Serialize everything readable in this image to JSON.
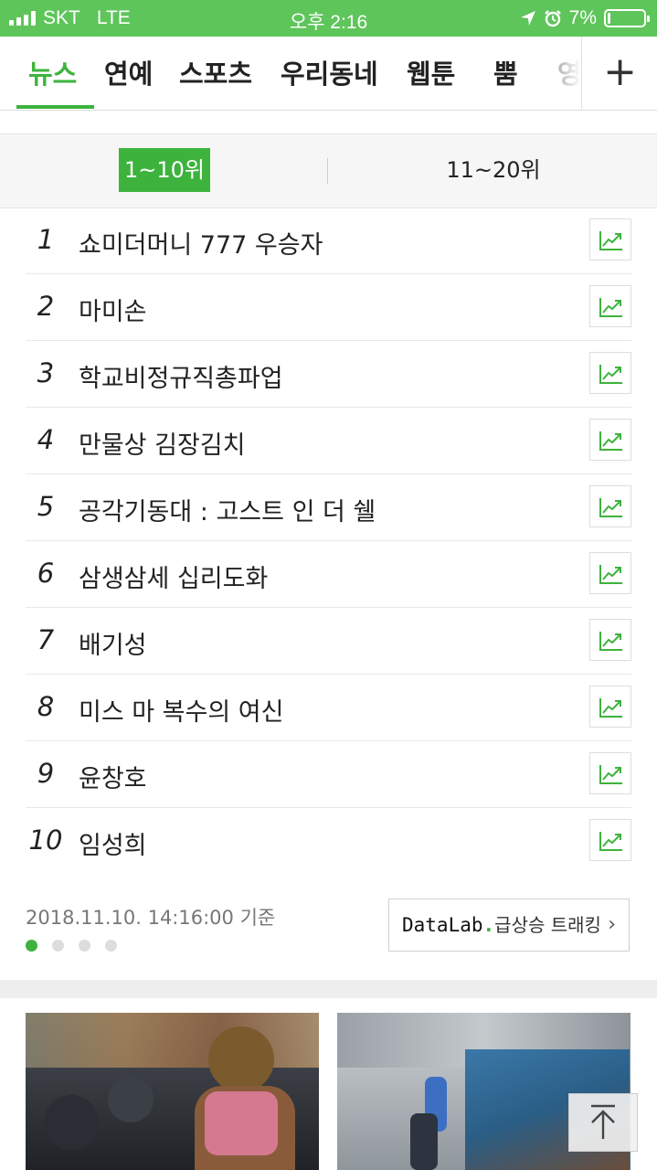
{
  "status_bar": {
    "carrier": "SKT",
    "network": "LTE",
    "time": "오후 2:16",
    "battery": "7%",
    "battery_level": 0.07
  },
  "nav": {
    "tabs": [
      {
        "label": "뉴스",
        "active": true
      },
      {
        "label": "연예",
        "active": false
      },
      {
        "label": "스포츠",
        "active": false
      },
      {
        "label": "우리동네",
        "active": false
      },
      {
        "label": "웹툰",
        "active": false
      },
      {
        "label": "뿜",
        "active": false
      },
      {
        "label": "영",
        "active": false
      }
    ],
    "plus_label": "+"
  },
  "ranking": {
    "range_tabs": [
      {
        "label": "1~10위",
        "active": true
      },
      {
        "label": "11~20위",
        "active": false
      }
    ],
    "items": [
      {
        "rank": "1",
        "keyword": "쇼미더머니 777 우승자"
      },
      {
        "rank": "2",
        "keyword": "마미손"
      },
      {
        "rank": "3",
        "keyword": "학교비정규직총파업"
      },
      {
        "rank": "4",
        "keyword": "만물상 김장김치"
      },
      {
        "rank": "5",
        "keyword": "공각기동대 : 고스트 인 더 쉘"
      },
      {
        "rank": "6",
        "keyword": "삼생삼세 십리도화"
      },
      {
        "rank": "7",
        "keyword": "배기성"
      },
      {
        "rank": "8",
        "keyword": "미스 마 복수의 여신"
      },
      {
        "rank": "9",
        "keyword": "윤창호"
      },
      {
        "rank": "10",
        "keyword": "임성희"
      }
    ],
    "timestamp": "2018.11.10. 14:16:00 기준",
    "page_dots": {
      "count": 4,
      "active": 1
    },
    "datalab": {
      "brand_prefix": "DataLab",
      "brand_dot": ".",
      "label": "급상승 트래킹",
      "chevron": "›"
    }
  },
  "icons": {
    "trend_icon": "trend-chart-icon",
    "top_icon": "arrow-up-icon"
  },
  "colors": {
    "accent": "#3db33d",
    "status_bar": "#5ec55a"
  }
}
